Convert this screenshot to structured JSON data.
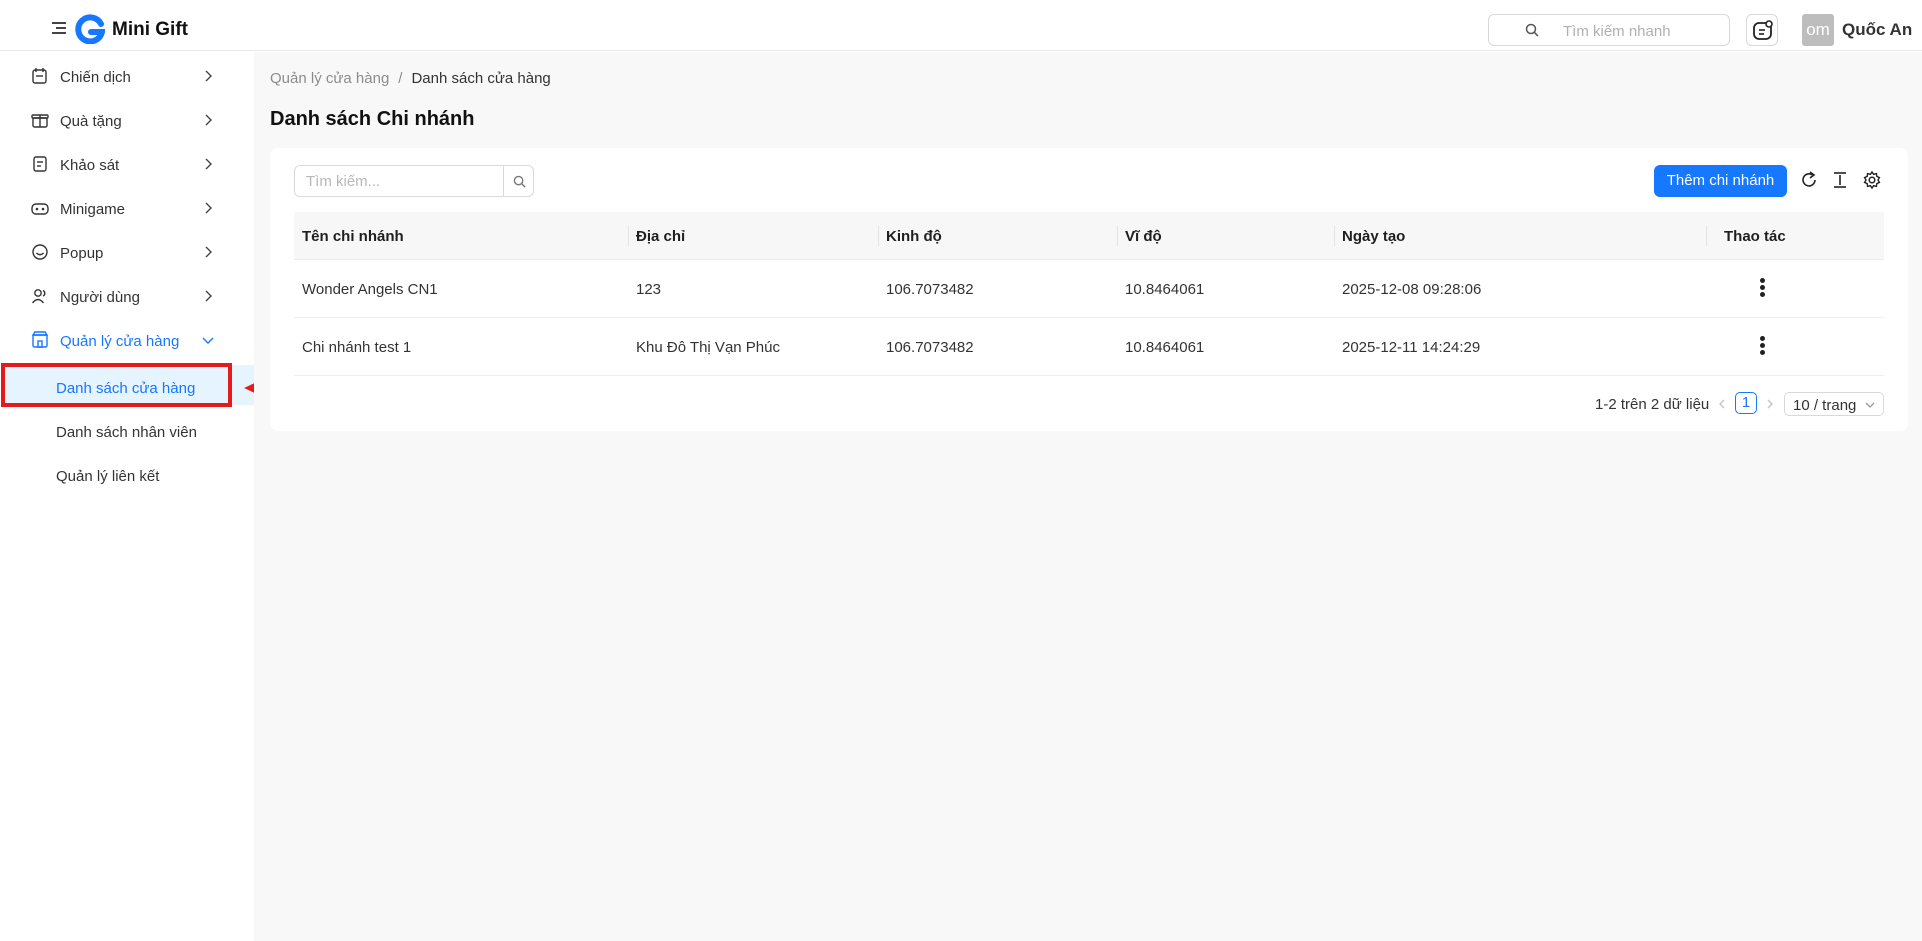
{
  "header": {
    "brand": "Mini Gift",
    "search_placeholder": "Tìm kiếm nhanh",
    "avatar_text": "om",
    "username": "Quốc An"
  },
  "sidebar": {
    "items": [
      {
        "label": "Chiến dịch",
        "icon": "campaign-icon"
      },
      {
        "label": "Quà tặng",
        "icon": "gift-icon"
      },
      {
        "label": "Khảo sát",
        "icon": "survey-icon"
      },
      {
        "label": "Minigame",
        "icon": "game-icon"
      },
      {
        "label": "Popup",
        "icon": "popup-icon"
      },
      {
        "label": "Người dùng",
        "icon": "users-icon"
      },
      {
        "label": "Quản lý cửa hàng",
        "icon": "store-icon"
      }
    ],
    "subitems": [
      {
        "label": "Danh sách cửa hàng"
      },
      {
        "label": "Danh sách nhân viên"
      },
      {
        "label": "Quản lý liên kết"
      }
    ]
  },
  "breadcrumb": {
    "parent": "Quản lý cửa hàng",
    "separator": "/",
    "current": "Danh sách cửa hàng"
  },
  "page": {
    "title": "Danh sách Chi nhánh",
    "search_placeholder": "Tìm kiếm...",
    "add_button": "Thêm chi nhánh"
  },
  "table": {
    "columns": [
      "Tên chi nhánh",
      "Địa chỉ",
      "Kinh độ",
      "Vĩ độ",
      "Ngày tạo",
      "Thao tác"
    ],
    "rows": [
      [
        "Wonder Angels CN1",
        "123",
        "106.7073482",
        "10.8464061",
        "2025-12-08 09:28:06"
      ],
      [
        "Chi nhánh test 1",
        "Khu Đô Thị Vạn Phúc",
        "106.7073482",
        "10.8464061",
        "2025-12-11 14:24:29"
      ]
    ]
  },
  "pagination": {
    "total": "1-2 trên 2 dữ liệu",
    "current_page": "1",
    "page_size": "10 / trang"
  },
  "colors": {
    "accent": "#1677ff",
    "annotation": "#e51b1b"
  }
}
